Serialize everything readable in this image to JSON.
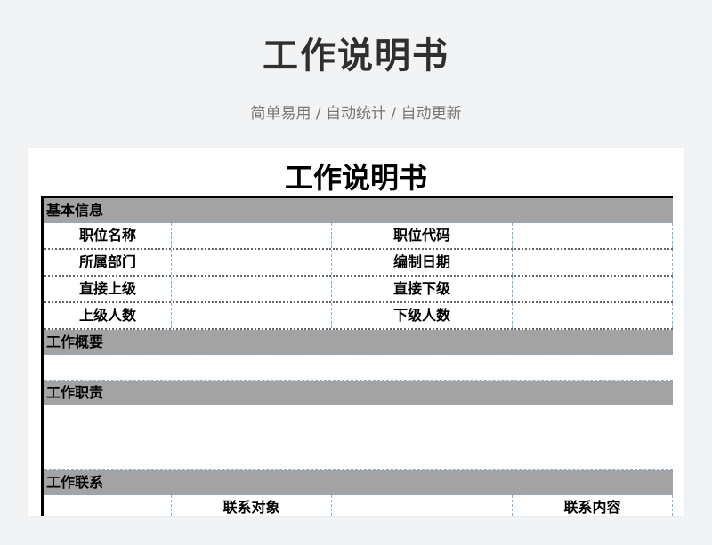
{
  "header": {
    "title": "工作说明书",
    "subtitle": "简单易用 / 自动统计 / 自动更新"
  },
  "sheet": {
    "title": "工作说明书",
    "basic_section": "基本信息",
    "rows": [
      {
        "l1": "职位名称",
        "l2": "职位代码"
      },
      {
        "l1": "所属部门",
        "l2": "编制日期"
      },
      {
        "l1": "直接上级",
        "l2": "直接下级"
      },
      {
        "l1": "上级人数",
        "l2": "下级人数"
      }
    ],
    "overview_section": "工作概要",
    "duties_section": "工作职责",
    "contact_section": "工作联系",
    "contact_headers": {
      "h1": "联系对象",
      "h2": "联系内容"
    }
  }
}
